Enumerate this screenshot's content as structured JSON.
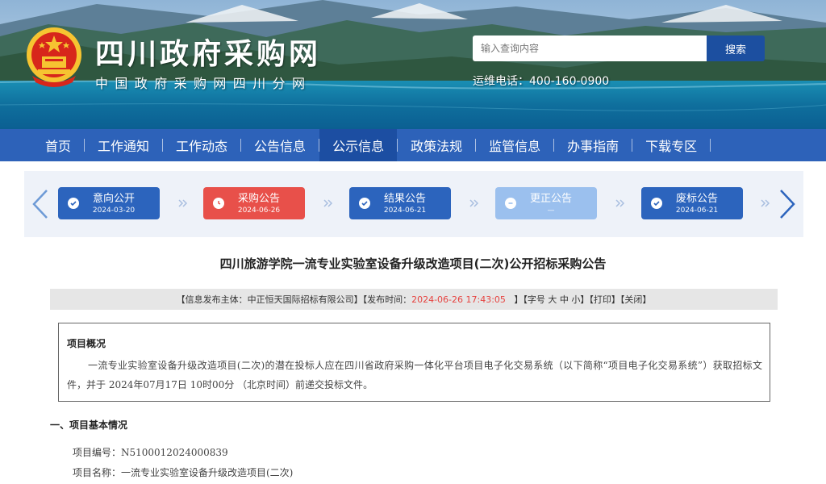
{
  "header": {
    "site_title": "四川政府采购网",
    "site_subtitle": "中国政府采购网四川分网",
    "search_placeholder": "输入查询内容",
    "search_button": "搜索",
    "hotline": "运维电话：400-160-0900"
  },
  "nav": {
    "items": [
      "首页",
      "工作通知",
      "工作动态",
      "公告信息",
      "公示信息",
      "政策法规",
      "监管信息",
      "办事指南",
      "下载专区"
    ],
    "active_index": 4
  },
  "steps": [
    {
      "label": "意向公开",
      "date": "2024-03-20",
      "status": "done"
    },
    {
      "label": "采购公告",
      "date": "2024-06-26",
      "status": "current"
    },
    {
      "label": "结果公告",
      "date": "2024-06-21",
      "status": "done"
    },
    {
      "label": "更正公告",
      "date": "—",
      "status": "pending"
    },
    {
      "label": "废标公告",
      "date": "2024-06-21",
      "status": "done"
    }
  ],
  "article": {
    "title": "四川旅游学院一流专业实验室设备升级改造项目(二次)公开招标采购公告",
    "info": {
      "publisher_part": "【信息发布主体：中正恒天国际招标有限公司】【发布时间：",
      "publish_time": "2024-06-26 17:43:05",
      "rest_part": "   】【字号 大 中 小】【打印】【关闭】"
    },
    "overview": {
      "heading": "项目概况",
      "body": "一流专业实验室设备升级改造项目(二次)的潜在投标人应在四川省政府采购一体化平台项目电子化交易系统（以下简称“项目电子化交易系统”）获取招标文件，并于 2024年07月17日 10时00分 （北京时间）前递交投标文件。"
    },
    "section1_heading": "一、项目基本情况",
    "fields": [
      "项目编号：N5100012024000839",
      "项目名称：一流专业实验室设备升级改造项目(二次)"
    ]
  },
  "colors": {
    "nav_bg": "#2d62b9",
    "nav_active": "#1c4ea2",
    "step_done": "#2c64bd",
    "step_current": "#e8504a",
    "step_pending": "#9bc0ee",
    "highlight_text": "#e64340"
  },
  "icons": {
    "emblem": "national-emblem",
    "step_done": "check-circle-icon",
    "step_current": "clock-icon",
    "step_pending": "minus-circle-icon",
    "arrows": "chevron-icons"
  }
}
